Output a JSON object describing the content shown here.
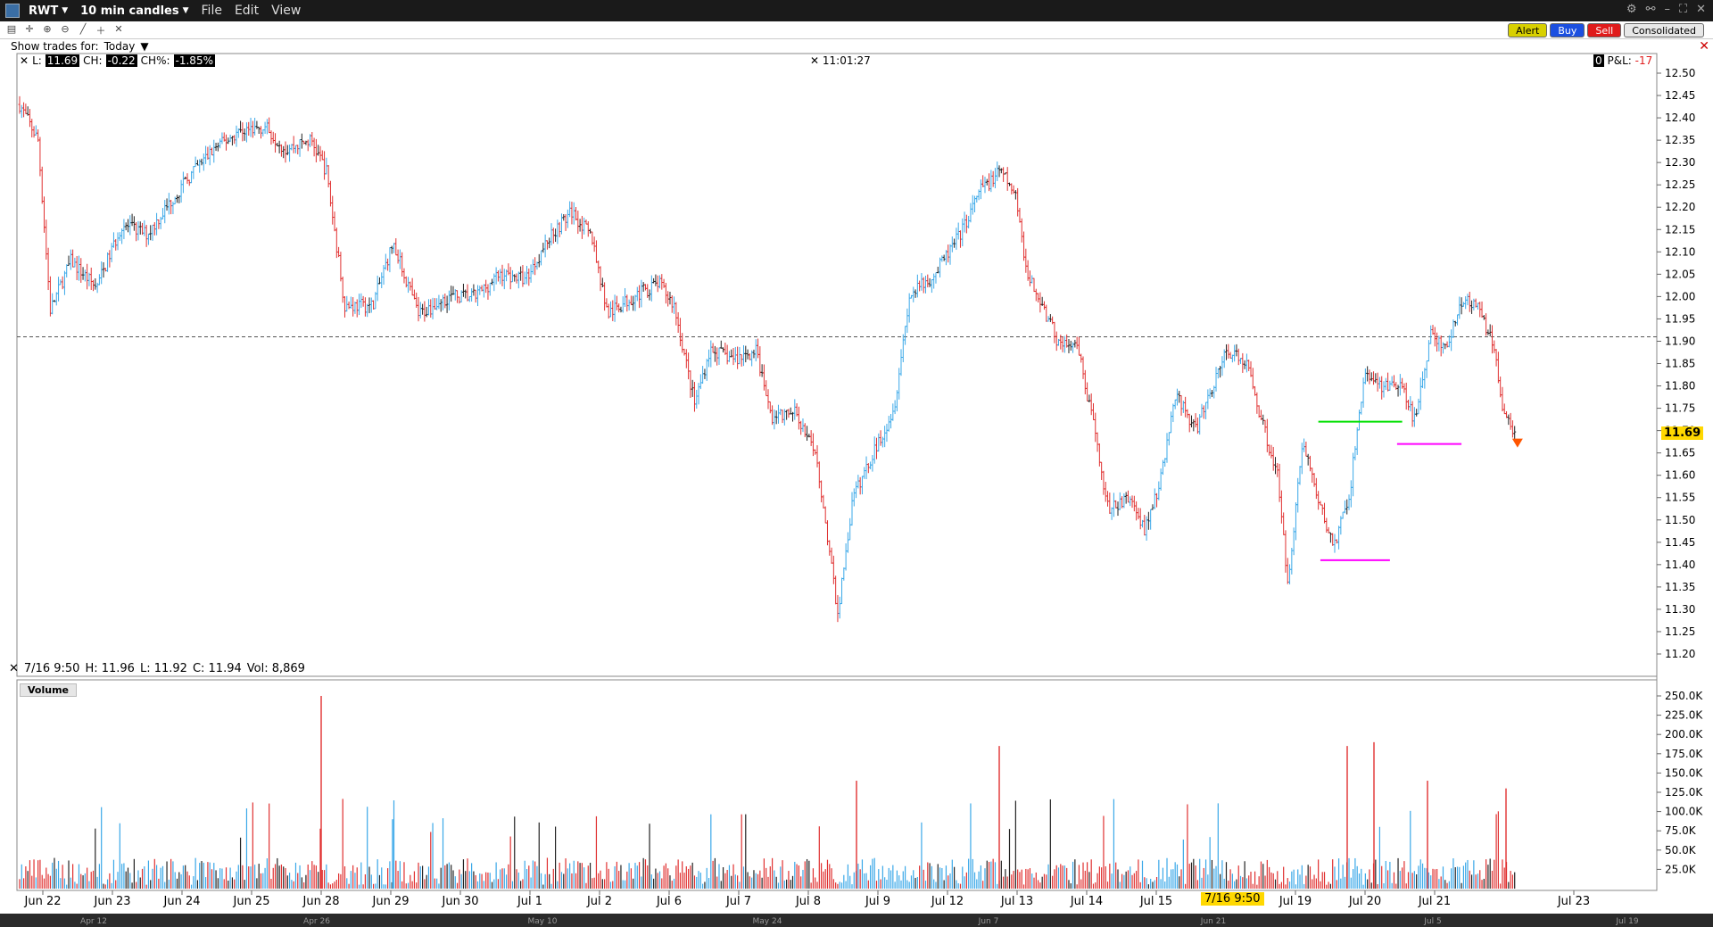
{
  "window": {
    "symbol": "RWT",
    "interval": "10 min candles",
    "menu": [
      "File",
      "Edit",
      "View"
    ]
  },
  "toolbar": {
    "show_trades_label": "Show trades for:",
    "show_trades_value": "Today",
    "alert_label": "Alert",
    "buy_label": "Buy",
    "sell_label": "Sell",
    "route_label": "Consolidated"
  },
  "header": {
    "last_label": "L:",
    "last_value": "11.69",
    "change_label": "CH:",
    "change_value": "-0.22",
    "change_pct_label": "CH%:",
    "change_pct_value": "-1.85%",
    "clock": "11:01:27",
    "pnl_label": "P&L:",
    "pnl_value": "-17"
  },
  "bar_info": {
    "date": "7/16 9:50",
    "high": "H: 11.96",
    "low": "L: 11.92",
    "close": "C: 11.94",
    "volume": "Vol: 8,869"
  },
  "volume_label": "Volume",
  "current_price_tag": "11.69",
  "x_hover_tag": "7/16 9:50",
  "colors": {
    "up": "#3aa8e8",
    "down": "#e03030",
    "neutral": "#222222",
    "green_line": "#00e000",
    "magenta_line": "#ff00ff",
    "current_price": "#ffd800",
    "marker": "#ff5500"
  },
  "chart_data": {
    "type": "candlestick",
    "y_price_ticks": [
      "12.50",
      "12.45",
      "12.40",
      "12.35",
      "12.30",
      "12.25",
      "12.20",
      "12.15",
      "12.10",
      "12.05",
      "12.00",
      "11.95",
      "11.90",
      "11.85",
      "11.80",
      "11.75",
      "11.70",
      "11.65",
      "11.60",
      "11.55",
      "11.50",
      "11.45",
      "11.40",
      "11.35",
      "11.30",
      "11.25",
      "11.20"
    ],
    "y_volume_ticks": [
      "250.0K",
      "225.0K",
      "200.0K",
      "175.0K",
      "150.0K",
      "125.0K",
      "100.0K",
      "75.0K",
      "50.0K",
      "25.0K"
    ],
    "x_ticks": [
      "Jun 22",
      "Jun 23",
      "Jun 24",
      "Jun 25",
      "Jun 28",
      "Jun 29",
      "Jun 30",
      "Jul 1",
      "Jul 2",
      "Jul 6",
      "Jul 7",
      "Jul 8",
      "Jul 9",
      "Jul 12",
      "Jul 13",
      "Jul 14",
      "Jul 15",
      "Jul 19",
      "Jul 20",
      "Jul 21",
      "Jul 23"
    ],
    "overview_ticks": [
      "Apr 12",
      "Apr 26",
      "May 10",
      "May 24",
      "Jun 7",
      "Jun 21",
      "Jul 5",
      "Jul 19"
    ],
    "price_range": [
      11.2,
      12.5
    ],
    "reference_line": 11.91,
    "path": [
      [
        0,
        12.43
      ],
      [
        18,
        12.35
      ],
      [
        30,
        11.97
      ],
      [
        50,
        12.08
      ],
      [
        75,
        12.02
      ],
      [
        100,
        12.16
      ],
      [
        125,
        12.14
      ],
      [
        150,
        12.22
      ],
      [
        170,
        12.28
      ],
      [
        190,
        12.33
      ],
      [
        215,
        12.37
      ],
      [
        240,
        12.38
      ],
      [
        260,
        12.33
      ],
      [
        285,
        12.35
      ],
      [
        300,
        12.28
      ],
      [
        318,
        11.98
      ],
      [
        345,
        11.98
      ],
      [
        365,
        12.12
      ],
      [
        390,
        11.96
      ],
      [
        420,
        12.0
      ],
      [
        445,
        12.0
      ],
      [
        470,
        12.05
      ],
      [
        495,
        12.04
      ],
      [
        520,
        12.14
      ],
      [
        540,
        12.19
      ],
      [
        560,
        12.13
      ],
      [
        575,
        11.96
      ],
      [
        600,
        12.0
      ],
      [
        625,
        12.03
      ],
      [
        640,
        11.98
      ],
      [
        660,
        11.76
      ],
      [
        675,
        11.88
      ],
      [
        700,
        11.86
      ],
      [
        720,
        11.88
      ],
      [
        735,
        11.73
      ],
      [
        760,
        11.74
      ],
      [
        780,
        11.63
      ],
      [
        800,
        11.29
      ],
      [
        815,
        11.55
      ],
      [
        835,
        11.65
      ],
      [
        855,
        11.75
      ],
      [
        870,
        12.0
      ],
      [
        895,
        12.05
      ],
      [
        920,
        12.14
      ],
      [
        940,
        12.24
      ],
      [
        960,
        12.28
      ],
      [
        975,
        12.22
      ],
      [
        985,
        12.05
      ],
      [
        1000,
        11.98
      ],
      [
        1015,
        11.9
      ],
      [
        1035,
        11.88
      ],
      [
        1050,
        11.71
      ],
      [
        1065,
        11.52
      ],
      [
        1085,
        11.55
      ],
      [
        1100,
        11.48
      ],
      [
        1115,
        11.58
      ],
      [
        1130,
        11.78
      ],
      [
        1150,
        11.7
      ],
      [
        1165,
        11.79
      ],
      [
        1180,
        11.88
      ],
      [
        1200,
        11.85
      ],
      [
        1215,
        11.72
      ],
      [
        1230,
        11.6
      ],
      [
        1240,
        11.36
      ],
      [
        1255,
        11.68
      ],
      [
        1270,
        11.54
      ],
      [
        1285,
        11.44
      ],
      [
        1300,
        11.55
      ],
      [
        1315,
        11.83
      ],
      [
        1330,
        11.8
      ],
      [
        1350,
        11.8
      ],
      [
        1365,
        11.72
      ],
      [
        1380,
        11.92
      ],
      [
        1395,
        11.88
      ],
      [
        1410,
        11.99
      ],
      [
        1425,
        11.98
      ],
      [
        1440,
        11.9
      ],
      [
        1450,
        11.76
      ],
      [
        1463,
        11.69
      ]
    ],
    "annotations": [
      {
        "type": "hline",
        "color": "green",
        "y": 11.72,
        "x_from_idx": 1270,
        "x_to_idx": 1352
      },
      {
        "type": "hline",
        "color": "magenta",
        "y": 11.67,
        "x_from_idx": 1347,
        "x_to_idx": 1410
      },
      {
        "type": "hline",
        "color": "magenta",
        "y": 11.41,
        "x_from_idx": 1272,
        "x_to_idx": 1340
      }
    ]
  }
}
